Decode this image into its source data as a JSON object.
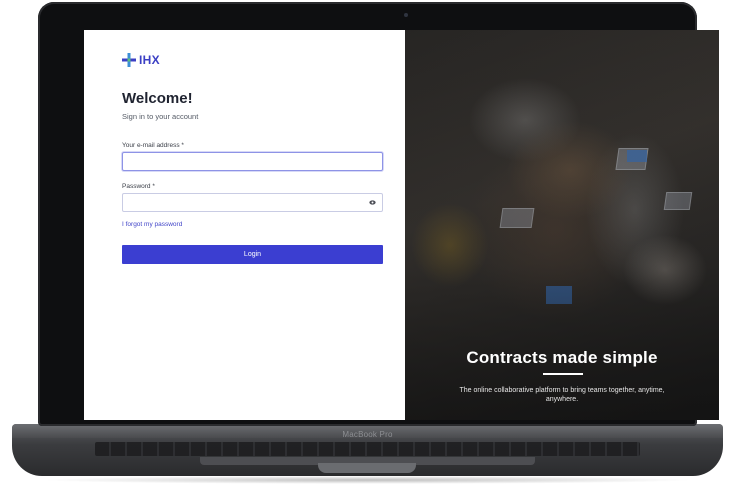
{
  "device": {
    "model_label": "MacBook Pro"
  },
  "login": {
    "logo_text": "IHX",
    "welcome_title": "Welcome!",
    "subtitle": "Sign in to your account",
    "email_label": "Your e-mail address *",
    "email_value": "",
    "password_label": "Password *",
    "password_value": "",
    "forgot_link": "I forgot my password",
    "login_button": "Login"
  },
  "hero": {
    "title": "Contracts made simple",
    "description": "The online collaborative platform to bring teams together, anytime, anywhere."
  },
  "colors": {
    "brand": "#3b3fc4",
    "button": "#3b3ed1",
    "link": "#4044c8"
  }
}
